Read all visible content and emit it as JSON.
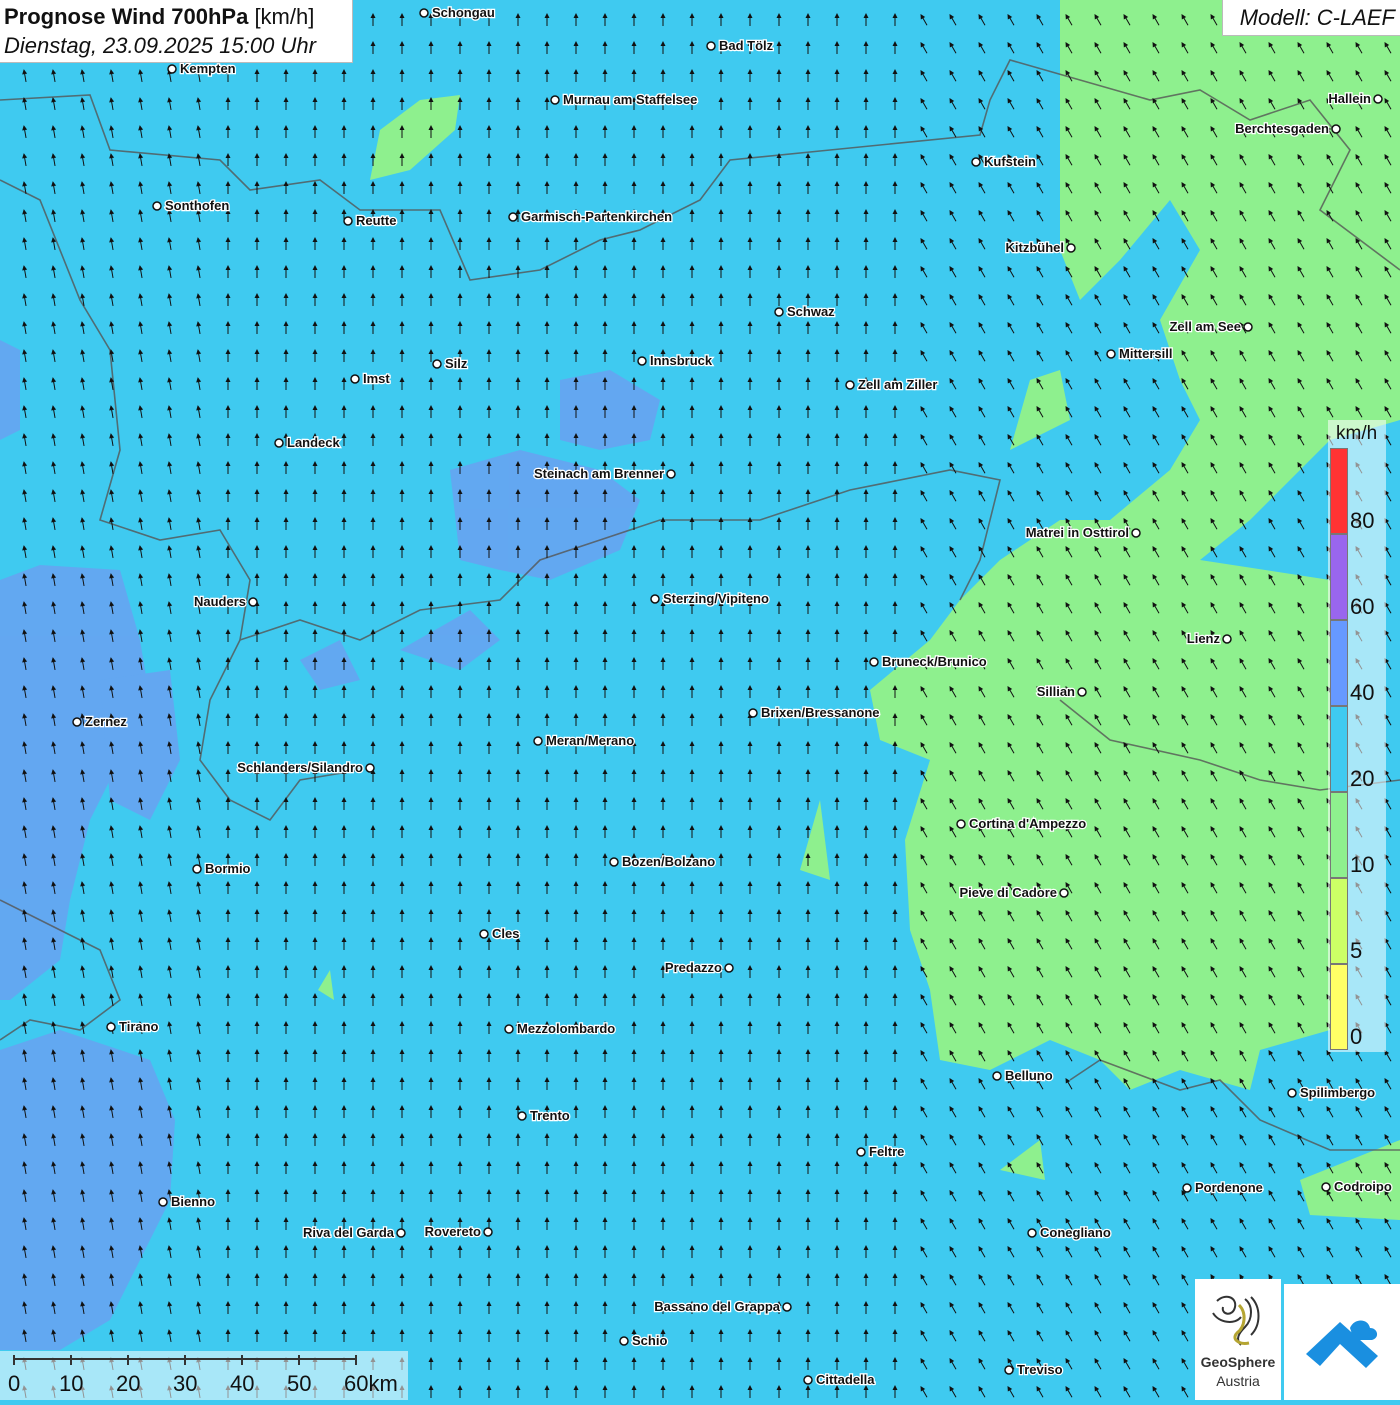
{
  "header": {
    "title_bold": "Prognose Wind 700hPa",
    "title_unit": "[km/h]",
    "datetime": "Dienstag, 23.09.2025 15:00 Uhr",
    "model": "Modell: C-LAEF"
  },
  "legend": {
    "unit": "km/h",
    "classes": [
      {
        "label": "0",
        "from": 0,
        "to": 5,
        "color": "#ffff66"
      },
      {
        "label": "5",
        "from": 5,
        "to": 10,
        "color": "#ccff66"
      },
      {
        "label": "10",
        "from": 10,
        "to": 20,
        "color": "#8ef08e"
      },
      {
        "label": "20",
        "from": 20,
        "to": 40,
        "color": "#3fcaf0"
      },
      {
        "label": "40",
        "from": 40,
        "to": 60,
        "color": "#6699ff"
      },
      {
        "label": "60",
        "from": 60,
        "to": 80,
        "color": "#9966ee"
      },
      {
        "label": "80",
        "from": 80,
        "to": 100,
        "color": "#ff3333"
      }
    ]
  },
  "scale_bar": {
    "labels": [
      "0",
      "10",
      "20",
      "30",
      "40",
      "50",
      "60km"
    ]
  },
  "logos": {
    "geosphere_line1": "GeoSphere",
    "geosphere_line2": "Austria"
  },
  "cities": [
    {
      "name": "Schongau"
    },
    {
      "name": "Bad Tölz"
    },
    {
      "name": "Kempten"
    },
    {
      "name": "Murnau am Staffelsee"
    },
    {
      "name": "Hallein"
    },
    {
      "name": "Berchtesgaden"
    },
    {
      "name": "Kufstein"
    },
    {
      "name": "Sonthofen"
    },
    {
      "name": "Reutte"
    },
    {
      "name": "Garmisch-Partenkirchen"
    },
    {
      "name": "Kitzbühel"
    },
    {
      "name": "Schwaz"
    },
    {
      "name": "Zell am See"
    },
    {
      "name": "Mittersill"
    },
    {
      "name": "Imst"
    },
    {
      "name": "Silz"
    },
    {
      "name": "Innsbruck"
    },
    {
      "name": "Zell am Ziller"
    },
    {
      "name": "Landeck"
    },
    {
      "name": "Steinach am Brenner"
    },
    {
      "name": "Matrei in Osttirol"
    },
    {
      "name": "Nauders"
    },
    {
      "name": "Sterzing/Vipiteno"
    },
    {
      "name": "Lienz"
    },
    {
      "name": "Bruneck/Brunico"
    },
    {
      "name": "Sillian"
    },
    {
      "name": "Zernez"
    },
    {
      "name": "Brixen/Bressanone"
    },
    {
      "name": "Meran/Merano"
    },
    {
      "name": "Schlanders/Silandro"
    },
    {
      "name": "Cortina d'Ampezzo"
    },
    {
      "name": "Bormio"
    },
    {
      "name": "Bozen/Bolzano"
    },
    {
      "name": "Pieve di Cadore"
    },
    {
      "name": "Cles"
    },
    {
      "name": "Predazzo"
    },
    {
      "name": "Tirano"
    },
    {
      "name": "Mezzolombardo"
    },
    {
      "name": "Belluno"
    },
    {
      "name": "Spilimbergo"
    },
    {
      "name": "Trento"
    },
    {
      "name": "Feltre"
    },
    {
      "name": "Pordenone"
    },
    {
      "name": "Codroipo"
    },
    {
      "name": "Bienno"
    },
    {
      "name": "Riva del Garda"
    },
    {
      "name": "Rovereto"
    },
    {
      "name": "Conegliano"
    },
    {
      "name": "Bassano del Grappa"
    },
    {
      "name": "Schio"
    },
    {
      "name": "Treviso"
    },
    {
      "name": "Cittadella"
    }
  ]
}
